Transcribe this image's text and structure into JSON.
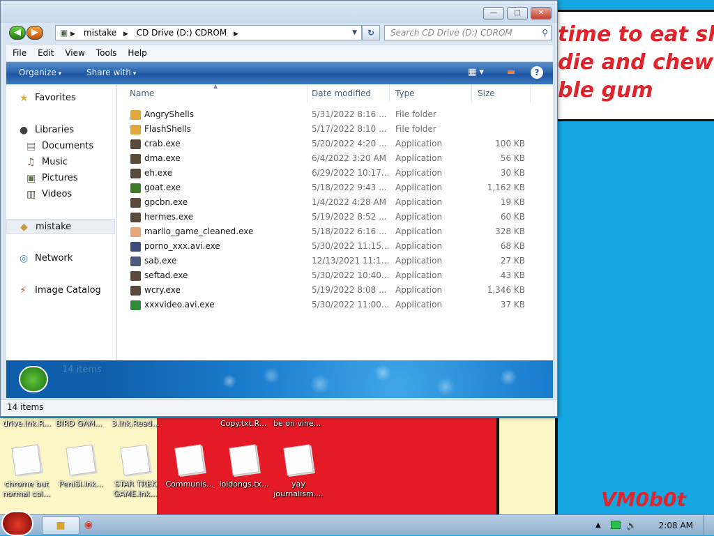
{
  "wallpaper": {
    "bubble_text": "time to eat shit\ndie and chew\nble gum",
    "tag": "VM0b0t"
  },
  "desktop": {
    "top_labels": [
      "drive.lnk.R...",
      "BIRD GAM...",
      "3.lnk.Read...",
      "Copy.txt.R...",
      "be on vine..."
    ],
    "icons": [
      {
        "label": "chrome but\nnormal col..."
      },
      {
        "label": "PeniSl.lnk..."
      },
      {
        "label": "STAR TREK\nGAME.lnk..."
      },
      {
        "label": "Communis..."
      },
      {
        "label": "loldongs.tx..."
      },
      {
        "label": "yay\njournalism...."
      }
    ]
  },
  "window": {
    "breadcrumb": [
      "mistake",
      "CD Drive (D:) CDROM"
    ],
    "search_placeholder": "Search CD Drive (D:) CDROM",
    "menu": [
      "File",
      "Edit",
      "View",
      "Tools",
      "Help"
    ],
    "commands": {
      "organize": "Organize",
      "share": "Share with"
    },
    "help_label": "?",
    "nav": [
      {
        "label": "Favorites",
        "icon": "star-icon",
        "sub": false
      },
      {
        "label": "Libraries",
        "icon": "library-icon",
        "sub": false
      },
      {
        "label": "Documents",
        "icon": "documents-icon",
        "sub": true
      },
      {
        "label": "Music",
        "icon": "music-icon",
        "sub": true
      },
      {
        "label": "Pictures",
        "icon": "pictures-icon",
        "sub": true
      },
      {
        "label": "Videos",
        "icon": "videos-icon",
        "sub": true
      },
      {
        "label": "mistake",
        "icon": "homegroup-icon",
        "sub": false,
        "selected": true
      },
      {
        "label": "Network",
        "icon": "network-icon",
        "sub": false
      },
      {
        "label": "Image Catalog",
        "icon": "image-catalog-icon",
        "sub": false
      }
    ],
    "columns": [
      "Name",
      "Date modified",
      "Type",
      "Size"
    ],
    "files": [
      {
        "name": "AngryShells",
        "date": "5/31/2022 8:16 ...",
        "type": "File folder",
        "size": "",
        "icon": "folder-icon",
        "color": "#e0a63a"
      },
      {
        "name": "FlashShells",
        "date": "5/17/2022 8:10 ...",
        "type": "File folder",
        "size": "",
        "icon": "folder-icon",
        "color": "#e0a63a"
      },
      {
        "name": "crab.exe",
        "date": "5/20/2022 4:20 ...",
        "type": "Application",
        "size": "100 KB",
        "icon": "exe-icon",
        "color": "#5a4a3a"
      },
      {
        "name": "dma.exe",
        "date": "6/4/2022 3:20 AM",
        "type": "Application",
        "size": "56 KB",
        "icon": "exe-icon",
        "color": "#5a4a3a"
      },
      {
        "name": "eh.exe",
        "date": "6/29/2022 10:17...",
        "type": "Application",
        "size": "30 KB",
        "icon": "exe-icon",
        "color": "#5a4a3a"
      },
      {
        "name": "goat.exe",
        "date": "5/18/2022 9:43 ...",
        "type": "Application",
        "size": "1,162 KB",
        "icon": "goat-exe-icon",
        "color": "#3f7a2a"
      },
      {
        "name": "gpcbn.exe",
        "date": "1/4/2022 4:28 AM",
        "type": "Application",
        "size": "19 KB",
        "icon": "exe-icon",
        "color": "#5a4a3a"
      },
      {
        "name": "hermes.exe",
        "date": "5/19/2022 8:52 ...",
        "type": "Application",
        "size": "60 KB",
        "icon": "exe-icon",
        "color": "#5a4a3a"
      },
      {
        "name": "marlio_game_cleaned.exe",
        "date": "5/18/2022 6:16 ...",
        "type": "Application",
        "size": "328 KB",
        "icon": "mario-exe-icon",
        "color": "#e8a57a"
      },
      {
        "name": "porno_xxx.avi.exe",
        "date": "5/30/2022 11:15...",
        "type": "Application",
        "size": "68 KB",
        "icon": "exe-icon",
        "color": "#3a4a7a"
      },
      {
        "name": "sab.exe",
        "date": "12/13/2021 11:1...",
        "type": "Application",
        "size": "27 KB",
        "icon": "computer-exe-icon",
        "color": "#4a5a7a"
      },
      {
        "name": "seftad.exe",
        "date": "5/30/2022 10:40...",
        "type": "Application",
        "size": "43 KB",
        "icon": "exe-icon",
        "color": "#5a4a3a"
      },
      {
        "name": "wcry.exe",
        "date": "5/19/2022 8:08 ...",
        "type": "Application",
        "size": "1,346 KB",
        "icon": "exe-icon",
        "color": "#5a4a3a"
      },
      {
        "name": "xxxvideo.avi.exe",
        "date": "5/30/2022 11:00...",
        "type": "Application",
        "size": "37 KB",
        "icon": "chrome-exe-icon",
        "color": "#2e8b3a"
      }
    ],
    "details_text": "14 items",
    "status_text": "14 items"
  },
  "taskbar": {
    "clock": "2:08 AM"
  }
}
